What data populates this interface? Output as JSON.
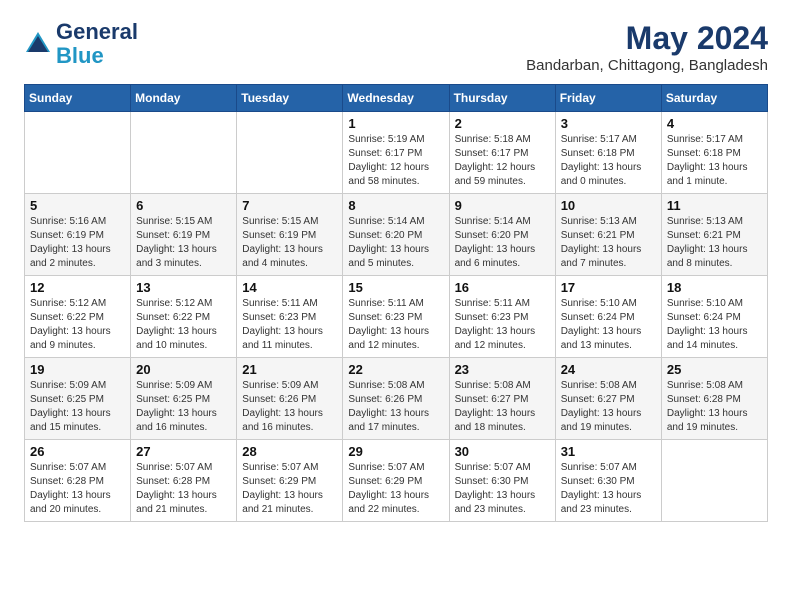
{
  "header": {
    "logo_line1": "General",
    "logo_line2": "Blue",
    "month": "May 2024",
    "location": "Bandarban, Chittagong, Bangladesh"
  },
  "weekdays": [
    "Sunday",
    "Monday",
    "Tuesday",
    "Wednesday",
    "Thursday",
    "Friday",
    "Saturday"
  ],
  "weeks": [
    [
      {
        "day": "",
        "info": ""
      },
      {
        "day": "",
        "info": ""
      },
      {
        "day": "",
        "info": ""
      },
      {
        "day": "1",
        "info": "Sunrise: 5:19 AM\nSunset: 6:17 PM\nDaylight: 12 hours\nand 58 minutes."
      },
      {
        "day": "2",
        "info": "Sunrise: 5:18 AM\nSunset: 6:17 PM\nDaylight: 12 hours\nand 59 minutes."
      },
      {
        "day": "3",
        "info": "Sunrise: 5:17 AM\nSunset: 6:18 PM\nDaylight: 13 hours\nand 0 minutes."
      },
      {
        "day": "4",
        "info": "Sunrise: 5:17 AM\nSunset: 6:18 PM\nDaylight: 13 hours\nand 1 minute."
      }
    ],
    [
      {
        "day": "5",
        "info": "Sunrise: 5:16 AM\nSunset: 6:19 PM\nDaylight: 13 hours\nand 2 minutes."
      },
      {
        "day": "6",
        "info": "Sunrise: 5:15 AM\nSunset: 6:19 PM\nDaylight: 13 hours\nand 3 minutes."
      },
      {
        "day": "7",
        "info": "Sunrise: 5:15 AM\nSunset: 6:19 PM\nDaylight: 13 hours\nand 4 minutes."
      },
      {
        "day": "8",
        "info": "Sunrise: 5:14 AM\nSunset: 6:20 PM\nDaylight: 13 hours\nand 5 minutes."
      },
      {
        "day": "9",
        "info": "Sunrise: 5:14 AM\nSunset: 6:20 PM\nDaylight: 13 hours\nand 6 minutes."
      },
      {
        "day": "10",
        "info": "Sunrise: 5:13 AM\nSunset: 6:21 PM\nDaylight: 13 hours\nand 7 minutes."
      },
      {
        "day": "11",
        "info": "Sunrise: 5:13 AM\nSunset: 6:21 PM\nDaylight: 13 hours\nand 8 minutes."
      }
    ],
    [
      {
        "day": "12",
        "info": "Sunrise: 5:12 AM\nSunset: 6:22 PM\nDaylight: 13 hours\nand 9 minutes."
      },
      {
        "day": "13",
        "info": "Sunrise: 5:12 AM\nSunset: 6:22 PM\nDaylight: 13 hours\nand 10 minutes."
      },
      {
        "day": "14",
        "info": "Sunrise: 5:11 AM\nSunset: 6:23 PM\nDaylight: 13 hours\nand 11 minutes."
      },
      {
        "day": "15",
        "info": "Sunrise: 5:11 AM\nSunset: 6:23 PM\nDaylight: 13 hours\nand 12 minutes."
      },
      {
        "day": "16",
        "info": "Sunrise: 5:11 AM\nSunset: 6:23 PM\nDaylight: 13 hours\nand 12 minutes."
      },
      {
        "day": "17",
        "info": "Sunrise: 5:10 AM\nSunset: 6:24 PM\nDaylight: 13 hours\nand 13 minutes."
      },
      {
        "day": "18",
        "info": "Sunrise: 5:10 AM\nSunset: 6:24 PM\nDaylight: 13 hours\nand 14 minutes."
      }
    ],
    [
      {
        "day": "19",
        "info": "Sunrise: 5:09 AM\nSunset: 6:25 PM\nDaylight: 13 hours\nand 15 minutes."
      },
      {
        "day": "20",
        "info": "Sunrise: 5:09 AM\nSunset: 6:25 PM\nDaylight: 13 hours\nand 16 minutes."
      },
      {
        "day": "21",
        "info": "Sunrise: 5:09 AM\nSunset: 6:26 PM\nDaylight: 13 hours\nand 16 minutes."
      },
      {
        "day": "22",
        "info": "Sunrise: 5:08 AM\nSunset: 6:26 PM\nDaylight: 13 hours\nand 17 minutes."
      },
      {
        "day": "23",
        "info": "Sunrise: 5:08 AM\nSunset: 6:27 PM\nDaylight: 13 hours\nand 18 minutes."
      },
      {
        "day": "24",
        "info": "Sunrise: 5:08 AM\nSunset: 6:27 PM\nDaylight: 13 hours\nand 19 minutes."
      },
      {
        "day": "25",
        "info": "Sunrise: 5:08 AM\nSunset: 6:28 PM\nDaylight: 13 hours\nand 19 minutes."
      }
    ],
    [
      {
        "day": "26",
        "info": "Sunrise: 5:07 AM\nSunset: 6:28 PM\nDaylight: 13 hours\nand 20 minutes."
      },
      {
        "day": "27",
        "info": "Sunrise: 5:07 AM\nSunset: 6:28 PM\nDaylight: 13 hours\nand 21 minutes."
      },
      {
        "day": "28",
        "info": "Sunrise: 5:07 AM\nSunset: 6:29 PM\nDaylight: 13 hours\nand 21 minutes."
      },
      {
        "day": "29",
        "info": "Sunrise: 5:07 AM\nSunset: 6:29 PM\nDaylight: 13 hours\nand 22 minutes."
      },
      {
        "day": "30",
        "info": "Sunrise: 5:07 AM\nSunset: 6:30 PM\nDaylight: 13 hours\nand 23 minutes."
      },
      {
        "day": "31",
        "info": "Sunrise: 5:07 AM\nSunset: 6:30 PM\nDaylight: 13 hours\nand 23 minutes."
      },
      {
        "day": "",
        "info": ""
      }
    ]
  ]
}
